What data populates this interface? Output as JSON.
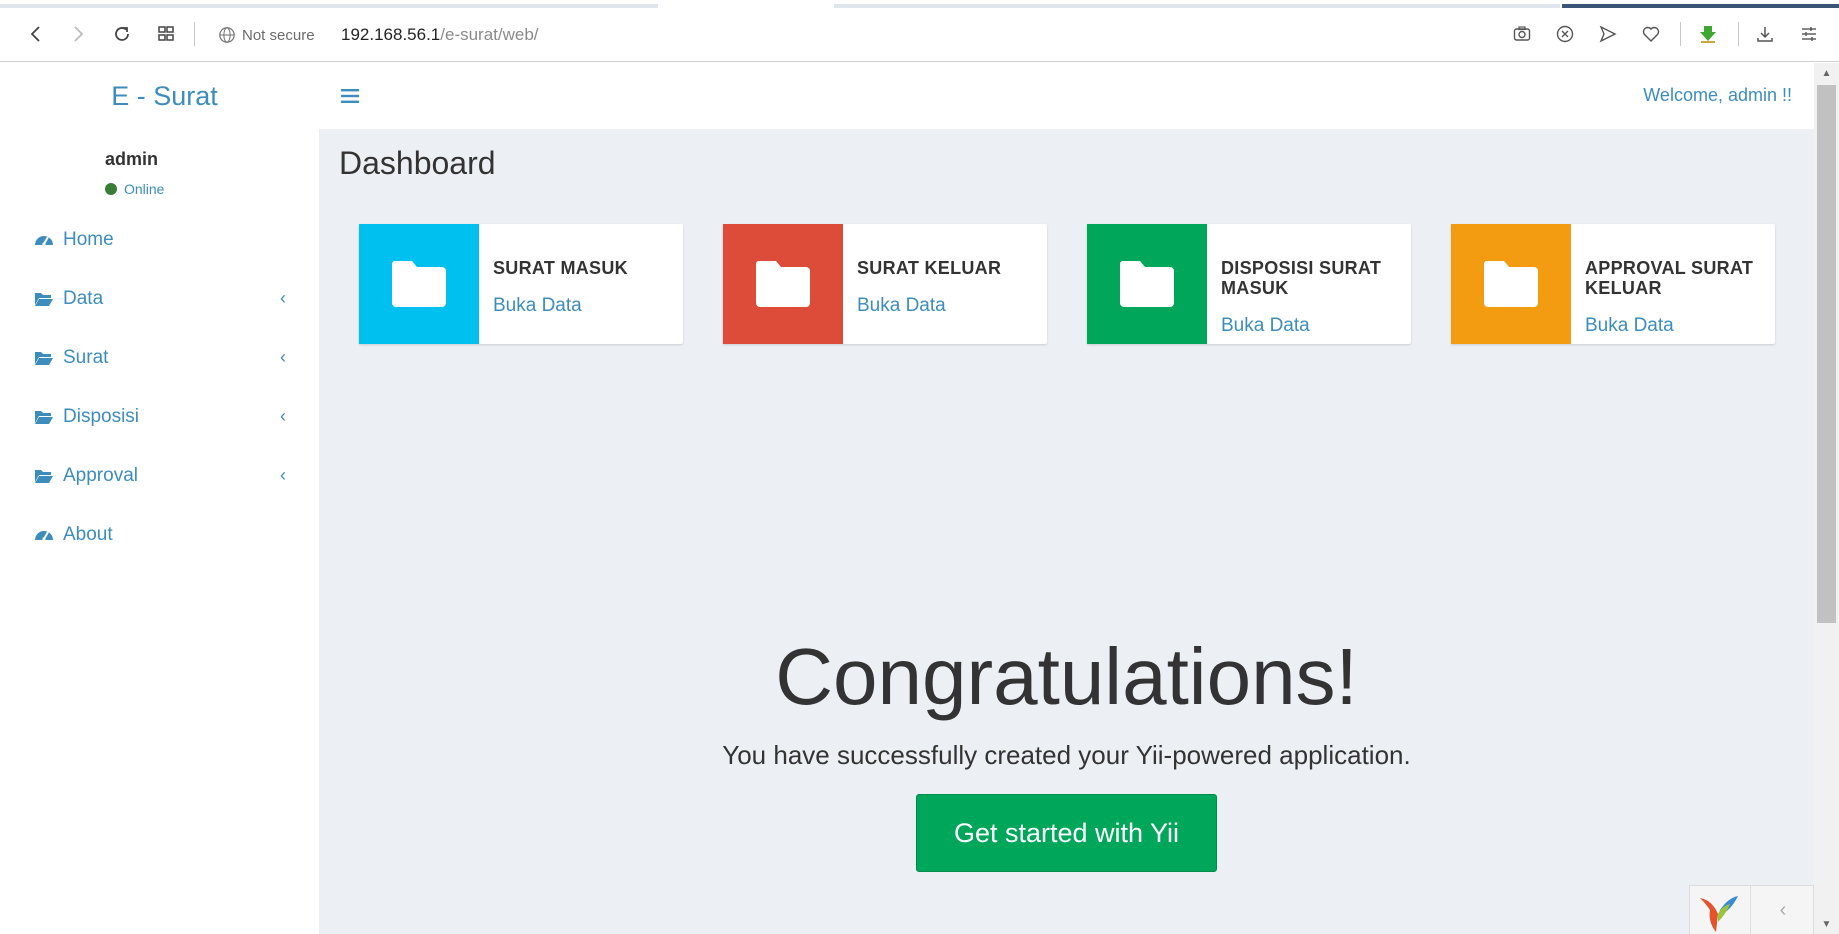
{
  "browser": {
    "security_label": "Not secure",
    "url_host": "192.168.56.1",
    "url_path": "/e-surat/web/"
  },
  "app": {
    "brand": "E - Surat",
    "user": {
      "name": "admin",
      "status": "Online"
    },
    "welcome": "Welcome, admin !!"
  },
  "sidebar": {
    "items": [
      {
        "label": "Home",
        "icon": "dashboard-icon",
        "caret": ""
      },
      {
        "label": "Data",
        "icon": "folder-open-icon",
        "caret": "‹"
      },
      {
        "label": "Surat",
        "icon": "folder-open-icon",
        "caret": "‹"
      },
      {
        "label": "Disposisi",
        "icon": "folder-open-icon",
        "caret": "‹"
      },
      {
        "label": "Approval",
        "icon": "folder-open-icon",
        "caret": "‹"
      },
      {
        "label": "About",
        "icon": "dashboard-icon",
        "caret": ""
      }
    ]
  },
  "content": {
    "title": "Dashboard",
    "boxes": [
      {
        "title": "SURAT MASUK",
        "link": "Buka Data",
        "color": "#00c0ef"
      },
      {
        "title": "SURAT KELUAR",
        "link": "Buka Data",
        "color": "#dd4b39"
      },
      {
        "title": "DISPOSISI SURAT MASUK",
        "link": "Buka Data",
        "color": "#00a65a"
      },
      {
        "title": "APPROVAL SURAT KELUAR",
        "link": "Buka Data",
        "color": "#f39c12"
      }
    ],
    "jumbotron": {
      "title": "Congratulations!",
      "lead": "You have successfully created your Yii-powered application.",
      "button": "Get started with Yii"
    }
  }
}
